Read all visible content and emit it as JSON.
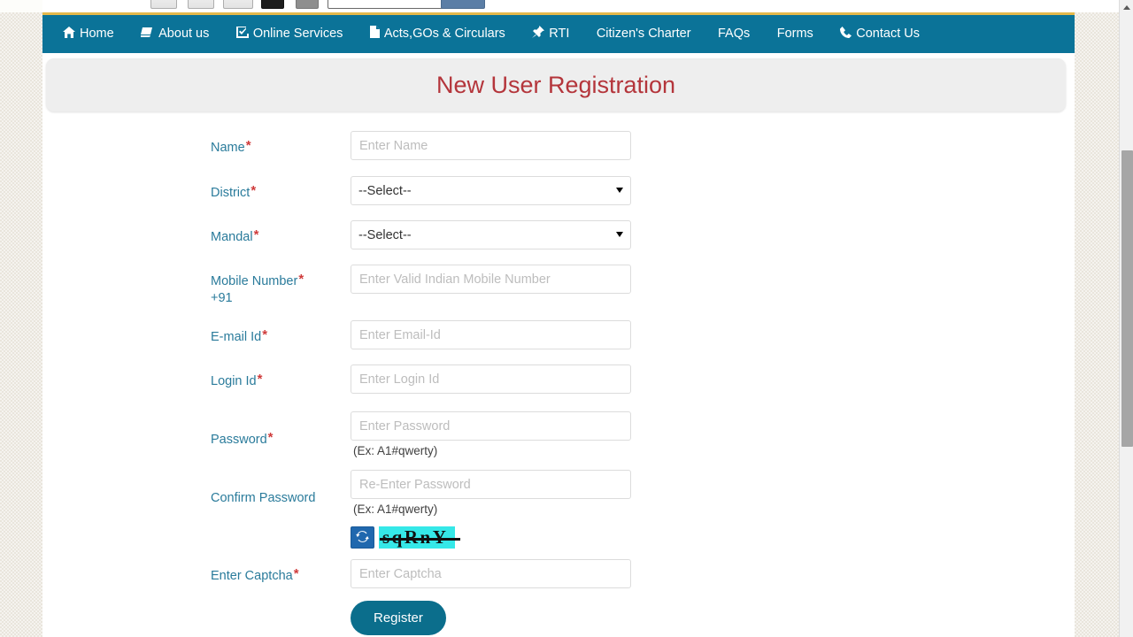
{
  "nav": {
    "items": [
      {
        "label": "Home",
        "icon": "home-icon"
      },
      {
        "label": "About us",
        "icon": "book-icon"
      },
      {
        "label": "Online Services",
        "icon": "checkbox-icon"
      },
      {
        "label": "Acts,GOs & Circulars",
        "icon": "document-icon"
      },
      {
        "label": "RTI",
        "icon": "pushpin-icon"
      },
      {
        "label": "Citizen's Charter",
        "icon": "none"
      },
      {
        "label": "FAQs",
        "icon": "none"
      },
      {
        "label": "Forms",
        "icon": "none"
      },
      {
        "label": "Contact Us",
        "icon": "phone-icon"
      }
    ]
  },
  "header": {
    "title": "New User Registration"
  },
  "form": {
    "name": {
      "label": "Name",
      "required": "*",
      "placeholder": "Enter Name",
      "value": ""
    },
    "district": {
      "label": "District",
      "required": "*",
      "selected": "--Select--",
      "options": [
        "--Select--"
      ]
    },
    "mandal": {
      "label": "Mandal",
      "required": "*",
      "selected": "--Select--",
      "options": [
        "--Select--"
      ]
    },
    "mobile": {
      "label": "Mobile Number",
      "required": "*",
      "prefix": "+91",
      "placeholder": "Enter Valid Indian Mobile Number",
      "value": ""
    },
    "email": {
      "label": "E-mail Id",
      "required": "*",
      "placeholder": "Enter Email-Id",
      "value": ""
    },
    "login_id": {
      "label": "Login Id",
      "required": "*",
      "placeholder": "Enter Login Id",
      "value": ""
    },
    "password": {
      "label": "Password",
      "required": "*",
      "placeholder": "Enter Password",
      "value": "",
      "hint": "(Ex: A1#qwerty)"
    },
    "confirm_password": {
      "label": "Confirm Password",
      "required": "",
      "placeholder": "Re-Enter Password",
      "value": "",
      "hint": "(Ex: A1#qwerty)"
    },
    "captcha": {
      "label": "Enter Captcha",
      "required": "*",
      "placeholder": "Enter Captcha",
      "value": "",
      "image_text": "sqRnY",
      "refresh_icon": "refresh-icon"
    },
    "submit": {
      "label": "Register"
    }
  },
  "colors": {
    "nav_background": "#0b7398",
    "nav_top_border": "#e4b84b",
    "title_text": "#b4353b",
    "label_text": "#2a7b9b",
    "required_asterisk": "#cf3b3b",
    "button_background": "#0b6e8c",
    "captcha_background": "#35e8e8",
    "page_background": "#e9e5dc"
  }
}
